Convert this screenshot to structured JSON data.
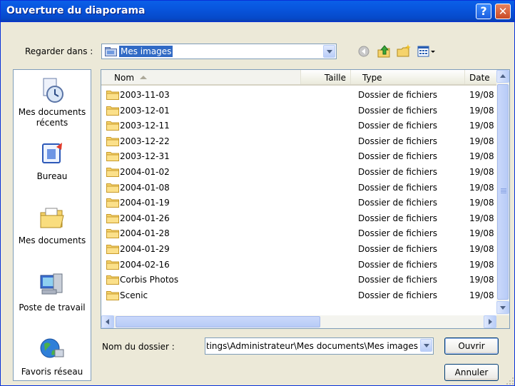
{
  "window": {
    "title": "Ouverture du diaporama"
  },
  "lookin": {
    "label": "Regarder dans :",
    "value": "Mes images"
  },
  "places": [
    {
      "label": "Mes documents récents",
      "icon": "recent-documents-icon"
    },
    {
      "label": "Bureau",
      "icon": "desktop-icon"
    },
    {
      "label": "Mes documents",
      "icon": "my-documents-icon"
    },
    {
      "label": "Poste de travail",
      "icon": "my-computer-icon"
    },
    {
      "label": "Favoris réseau",
      "icon": "network-places-icon"
    }
  ],
  "columns": {
    "name": "Nom",
    "size": "Taille",
    "type": "Type",
    "date": "Date"
  },
  "files": [
    {
      "name": "2003-11-03",
      "type": "Dossier de fichiers",
      "date": "19/08"
    },
    {
      "name": "2003-12-01",
      "type": "Dossier de fichiers",
      "date": "19/08"
    },
    {
      "name": "2003-12-11",
      "type": "Dossier de fichiers",
      "date": "19/08"
    },
    {
      "name": "2003-12-22",
      "type": "Dossier de fichiers",
      "date": "19/08"
    },
    {
      "name": "2003-12-31",
      "type": "Dossier de fichiers",
      "date": "19/08"
    },
    {
      "name": "2004-01-02",
      "type": "Dossier de fichiers",
      "date": "19/08"
    },
    {
      "name": "2004-01-08",
      "type": "Dossier de fichiers",
      "date": "19/08"
    },
    {
      "name": "2004-01-19",
      "type": "Dossier de fichiers",
      "date": "19/08"
    },
    {
      "name": "2004-01-26",
      "type": "Dossier de fichiers",
      "date": "19/08"
    },
    {
      "name": "2004-01-28",
      "type": "Dossier de fichiers",
      "date": "19/08"
    },
    {
      "name": "2004-01-29",
      "type": "Dossier de fichiers",
      "date": "19/08"
    },
    {
      "name": "2004-02-16",
      "type": "Dossier de fichiers",
      "date": "19/08"
    },
    {
      "name": "Corbis Photos",
      "type": "Dossier de fichiers",
      "date": "19/08"
    },
    {
      "name": "Scenic",
      "type": "Dossier de fichiers",
      "date": "19/08"
    }
  ],
  "folder_name": {
    "label": "Nom du dossier :",
    "value": "C:\\Documents and Settings\\Administrateur\\Mes documents\\Mes images"
  },
  "buttons": {
    "open": "Ouvrir",
    "cancel": "Annuler"
  },
  "colors": {
    "titlebar": "#0855dd",
    "selection": "#316ac5",
    "folder": "#f5d36b",
    "dialog_bg": "#ece9d8"
  }
}
